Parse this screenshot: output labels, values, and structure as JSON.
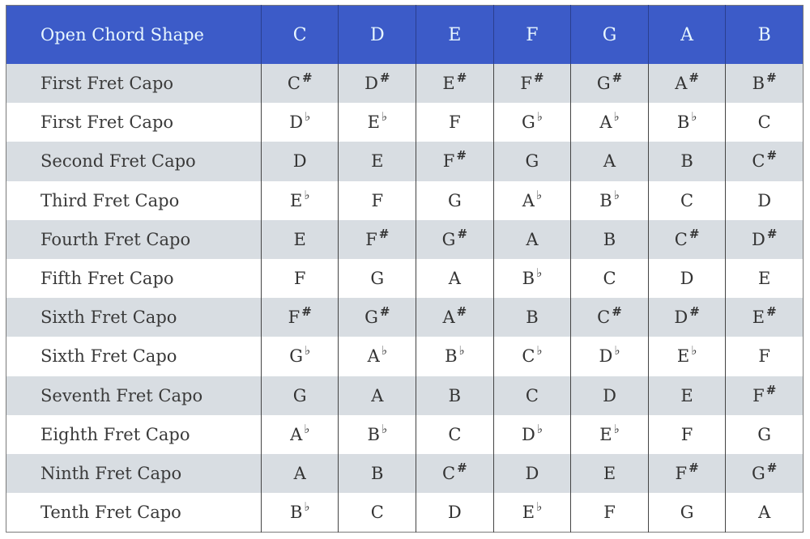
{
  "header": {
    "label": "Open Chord Shape",
    "keys": [
      "C",
      "D",
      "E",
      "F",
      "G",
      "A",
      "B"
    ]
  },
  "accidental_symbols": {
    "sharp": "#",
    "flat": "♭"
  },
  "rows": [
    {
      "label": "First Fret Capo",
      "cells": [
        [
          "C",
          "#"
        ],
        [
          "D",
          "#"
        ],
        [
          "E",
          "#"
        ],
        [
          "F",
          "#"
        ],
        [
          "G",
          "#"
        ],
        [
          "A",
          "#"
        ],
        [
          "B",
          "#"
        ]
      ]
    },
    {
      "label": "First Fret Capo",
      "cells": [
        [
          "D",
          "♭"
        ],
        [
          "E",
          "♭"
        ],
        [
          "F",
          ""
        ],
        [
          "G",
          "♭"
        ],
        [
          "A",
          "♭"
        ],
        [
          "B",
          "♭"
        ],
        [
          "C",
          ""
        ]
      ]
    },
    {
      "label": "Second Fret Capo",
      "cells": [
        [
          "D",
          ""
        ],
        [
          "E",
          ""
        ],
        [
          "F",
          "#"
        ],
        [
          "G",
          ""
        ],
        [
          "A",
          ""
        ],
        [
          "B",
          ""
        ],
        [
          "C",
          "#"
        ]
      ]
    },
    {
      "label": "Third Fret Capo",
      "cells": [
        [
          "E",
          "♭"
        ],
        [
          "F",
          ""
        ],
        [
          "G",
          ""
        ],
        [
          "A",
          "♭"
        ],
        [
          "B",
          "♭"
        ],
        [
          "C",
          ""
        ],
        [
          "D",
          ""
        ]
      ]
    },
    {
      "label": "Fourth Fret Capo",
      "cells": [
        [
          "E",
          ""
        ],
        [
          "F",
          "#"
        ],
        [
          "G",
          "#"
        ],
        [
          "A",
          ""
        ],
        [
          "B",
          ""
        ],
        [
          "C",
          "#"
        ],
        [
          "D",
          "#"
        ]
      ]
    },
    {
      "label": "Fifth Fret Capo",
      "cells": [
        [
          "F",
          ""
        ],
        [
          "G",
          ""
        ],
        [
          "A",
          ""
        ],
        [
          "B",
          "♭"
        ],
        [
          "C",
          ""
        ],
        [
          "D",
          ""
        ],
        [
          "E",
          ""
        ]
      ]
    },
    {
      "label": "Sixth Fret Capo",
      "cells": [
        [
          "F",
          "#"
        ],
        [
          "G",
          "#"
        ],
        [
          "A",
          "#"
        ],
        [
          "B",
          ""
        ],
        [
          "C",
          "#"
        ],
        [
          "D",
          "#"
        ],
        [
          "E",
          "#"
        ]
      ]
    },
    {
      "label": "Sixth Fret Capo",
      "cells": [
        [
          "G",
          "♭"
        ],
        [
          "A",
          "♭"
        ],
        [
          "B",
          "♭"
        ],
        [
          "C",
          "♭"
        ],
        [
          "D",
          "♭"
        ],
        [
          "E",
          "♭"
        ],
        [
          "F",
          ""
        ]
      ]
    },
    {
      "label": "Seventh Fret Capo",
      "cells": [
        [
          "G",
          ""
        ],
        [
          "A",
          ""
        ],
        [
          "B",
          ""
        ],
        [
          "C",
          ""
        ],
        [
          "D",
          ""
        ],
        [
          "E",
          ""
        ],
        [
          "F",
          "#"
        ]
      ]
    },
    {
      "label": "Eighth Fret Capo",
      "cells": [
        [
          "A",
          "♭"
        ],
        [
          "B",
          "♭"
        ],
        [
          "C",
          ""
        ],
        [
          "D",
          "♭"
        ],
        [
          "E",
          "♭"
        ],
        [
          "F",
          ""
        ],
        [
          "G",
          ""
        ]
      ]
    },
    {
      "label": "Ninth Fret Capo",
      "cells": [
        [
          "A",
          ""
        ],
        [
          "B",
          ""
        ],
        [
          "C",
          "#"
        ],
        [
          "D",
          ""
        ],
        [
          "E",
          ""
        ],
        [
          "F",
          "#"
        ],
        [
          "G",
          "#"
        ]
      ]
    },
    {
      "label": "Tenth Fret Capo",
      "cells": [
        [
          "B",
          "♭"
        ],
        [
          "C",
          ""
        ],
        [
          "D",
          ""
        ],
        [
          "E",
          "♭"
        ],
        [
          "F",
          ""
        ],
        [
          "G",
          ""
        ],
        [
          "A",
          ""
        ]
      ]
    }
  ]
}
